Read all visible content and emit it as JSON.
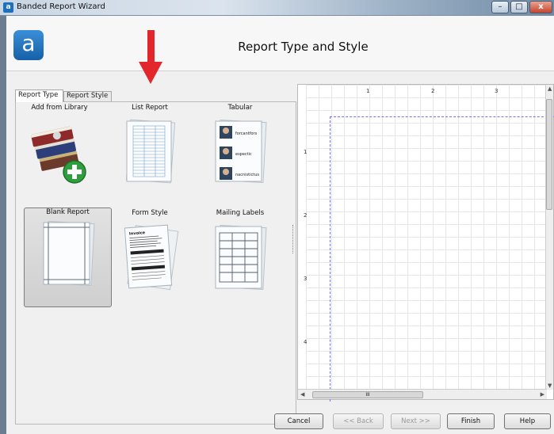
{
  "window": {
    "title": "Banded Report Wizard",
    "icon_letter": "a",
    "controls": {
      "minimize": "–",
      "maximize": "□",
      "close": "x"
    }
  },
  "header": {
    "logo_letter": "a",
    "title": "Report Type and Style"
  },
  "tabs": [
    {
      "label": "Report Type",
      "active": true
    },
    {
      "label": "Report Style",
      "active": false
    }
  ],
  "report_types": [
    {
      "label": "Add from Library",
      "icon": "library-books-add-icon",
      "selected": false
    },
    {
      "label": "List Report",
      "icon": "list-report-icon",
      "selected": false
    },
    {
      "label": "Tabular",
      "icon": "tabular-report-icon",
      "selected": false
    },
    {
      "label": "Blank Report",
      "icon": "blank-report-icon",
      "selected": true
    },
    {
      "label": "Form Style",
      "icon": "form-style-icon",
      "selected": false
    },
    {
      "label": "Mailing Labels",
      "icon": "mailing-labels-icon",
      "selected": false
    }
  ],
  "tabular_names": [
    "forcantfors",
    "espectic",
    "nacnistictus"
  ],
  "form_heading": "Invoice",
  "preview": {
    "ruler_top": [
      "1",
      "2",
      "3"
    ],
    "ruler_left": [
      "1",
      "2",
      "3",
      "4"
    ],
    "hscroll_grip": "III"
  },
  "buttons": {
    "cancel": "Cancel",
    "back": "<< Back",
    "next": "Next >>",
    "finish": "Finish",
    "help": "Help"
  },
  "colors": {
    "annotation_arrow": "#e3262b",
    "logo": "#1f6fbf",
    "page_outline": "#7070ff"
  }
}
